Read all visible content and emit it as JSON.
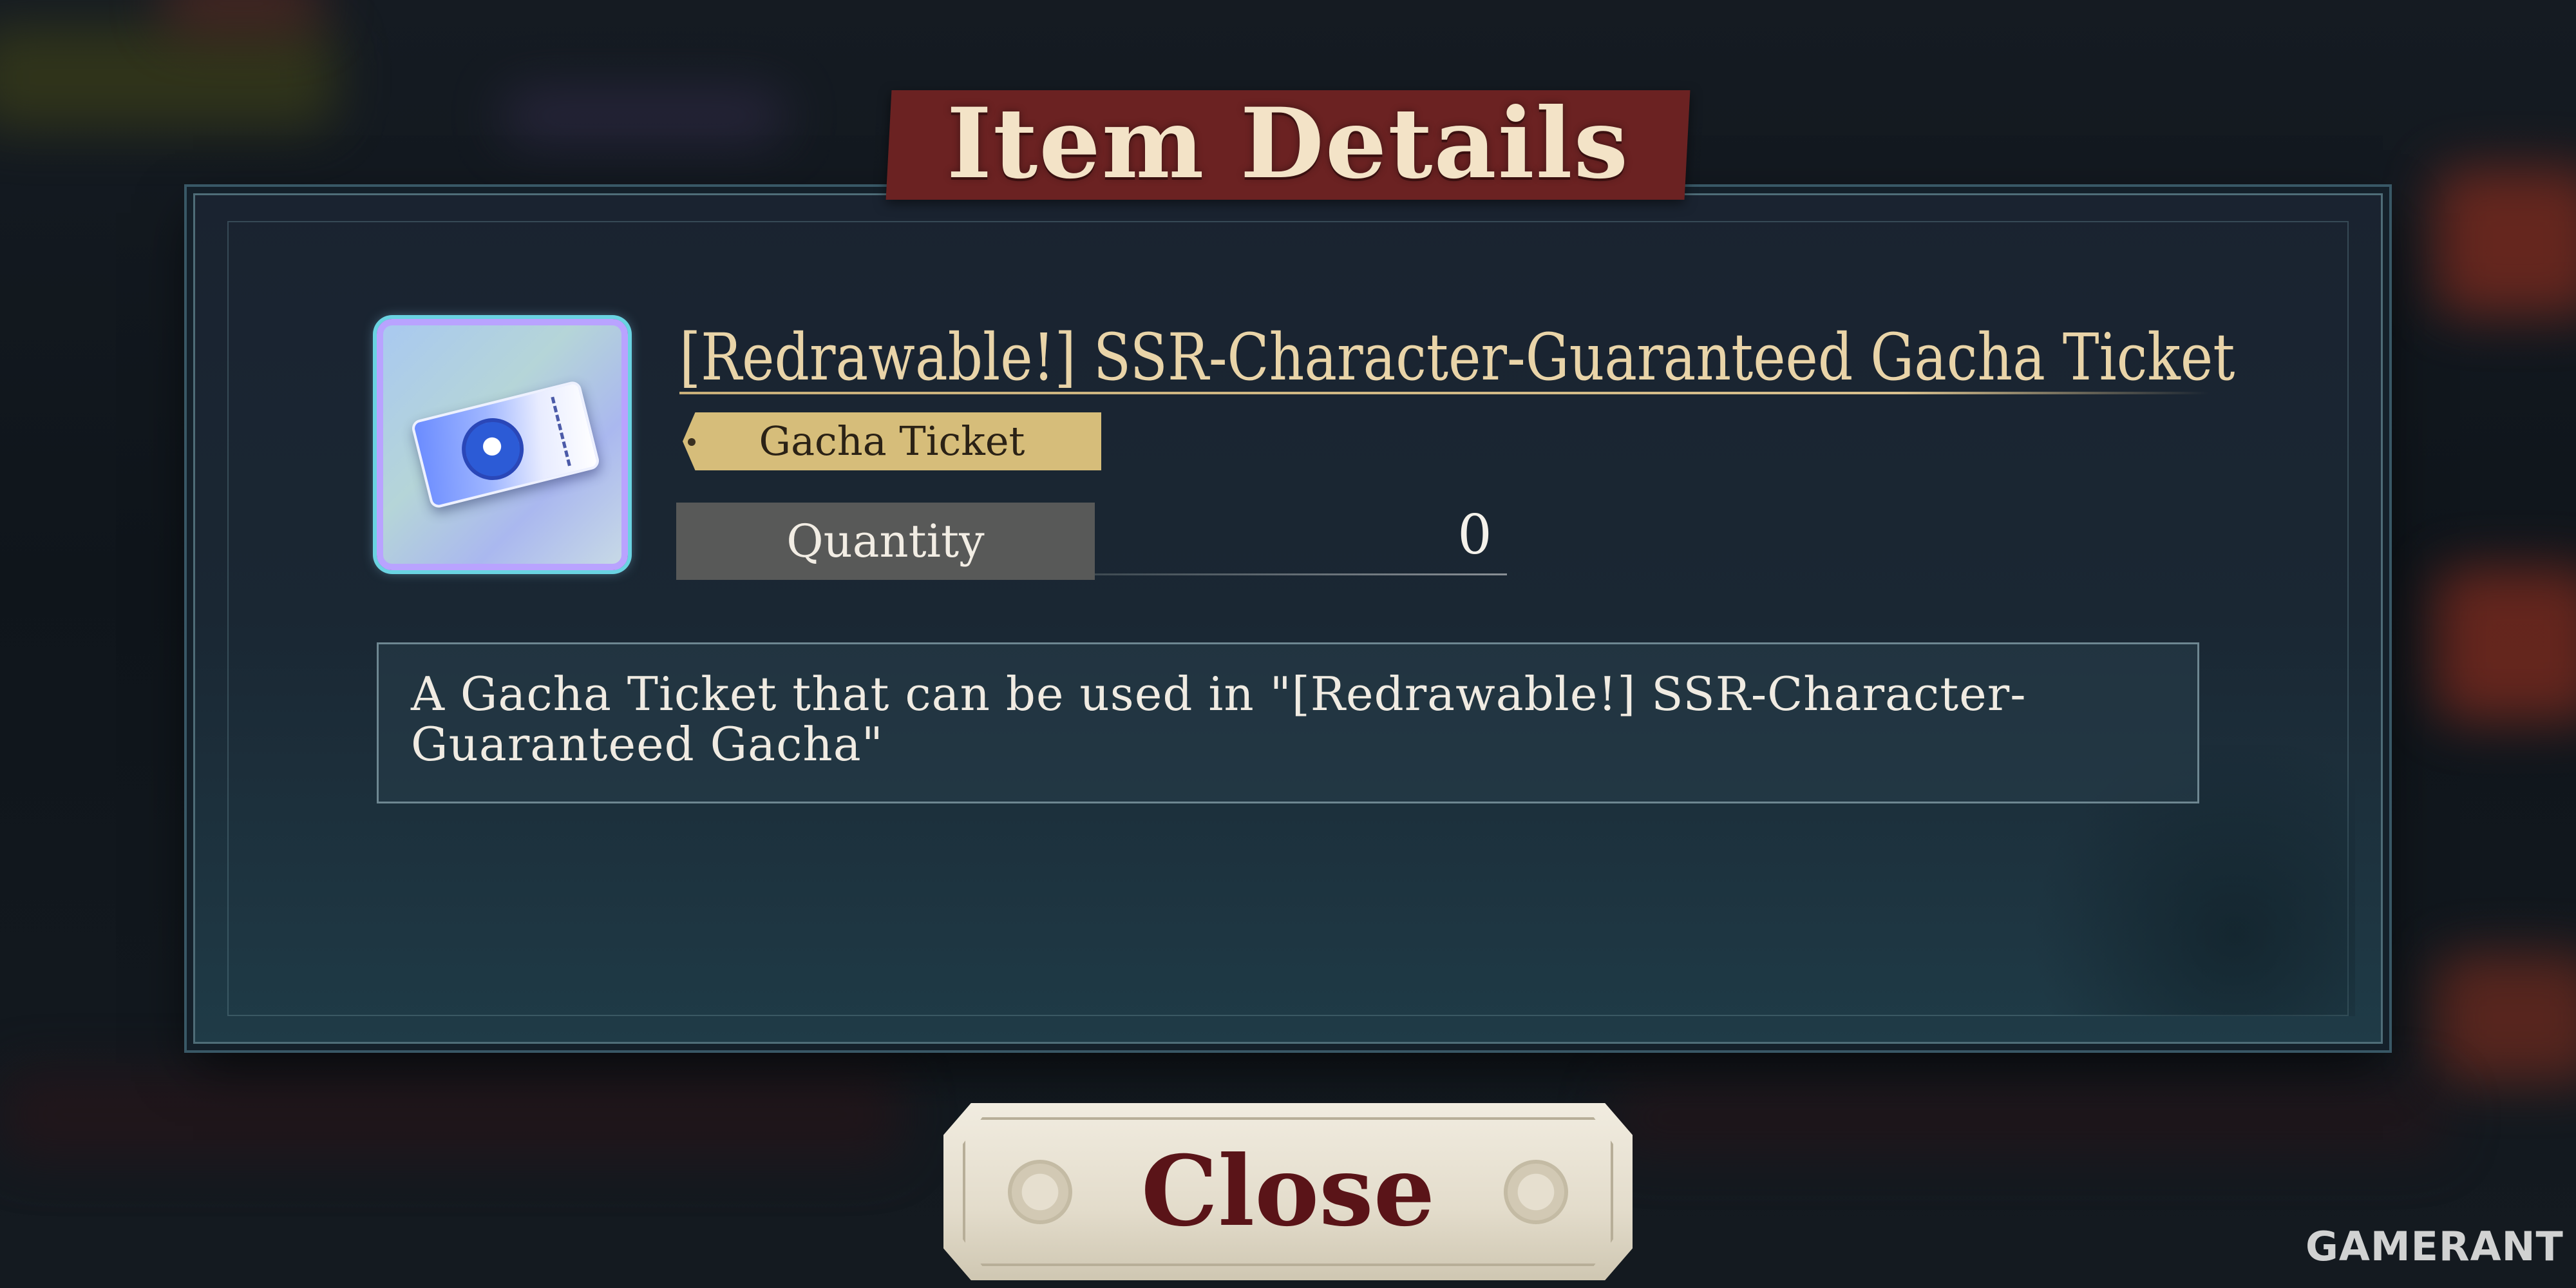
{
  "dialog": {
    "title": "Item Details",
    "item": {
      "icon": "gacha-ticket-icon",
      "name": "[Redrawable!] SSR-Character-Guaranteed Gacha Ticket",
      "category": "Gacha Ticket",
      "quantity_label": "Quantity",
      "quantity_value": "0",
      "description": "A Gacha Ticket that can be used in \"[Redrawable!] SSR-Character-Guaranteed Gacha\""
    },
    "close_label": "Close"
  },
  "watermark": "GAMERANT",
  "colors": {
    "title_banner": "#6b2222",
    "title_text": "#f3e3c7",
    "item_name": "#e9d4a8",
    "category_tag": "#d6bd7a",
    "quantity_box": "#585958",
    "close_text": "#5a1418"
  }
}
